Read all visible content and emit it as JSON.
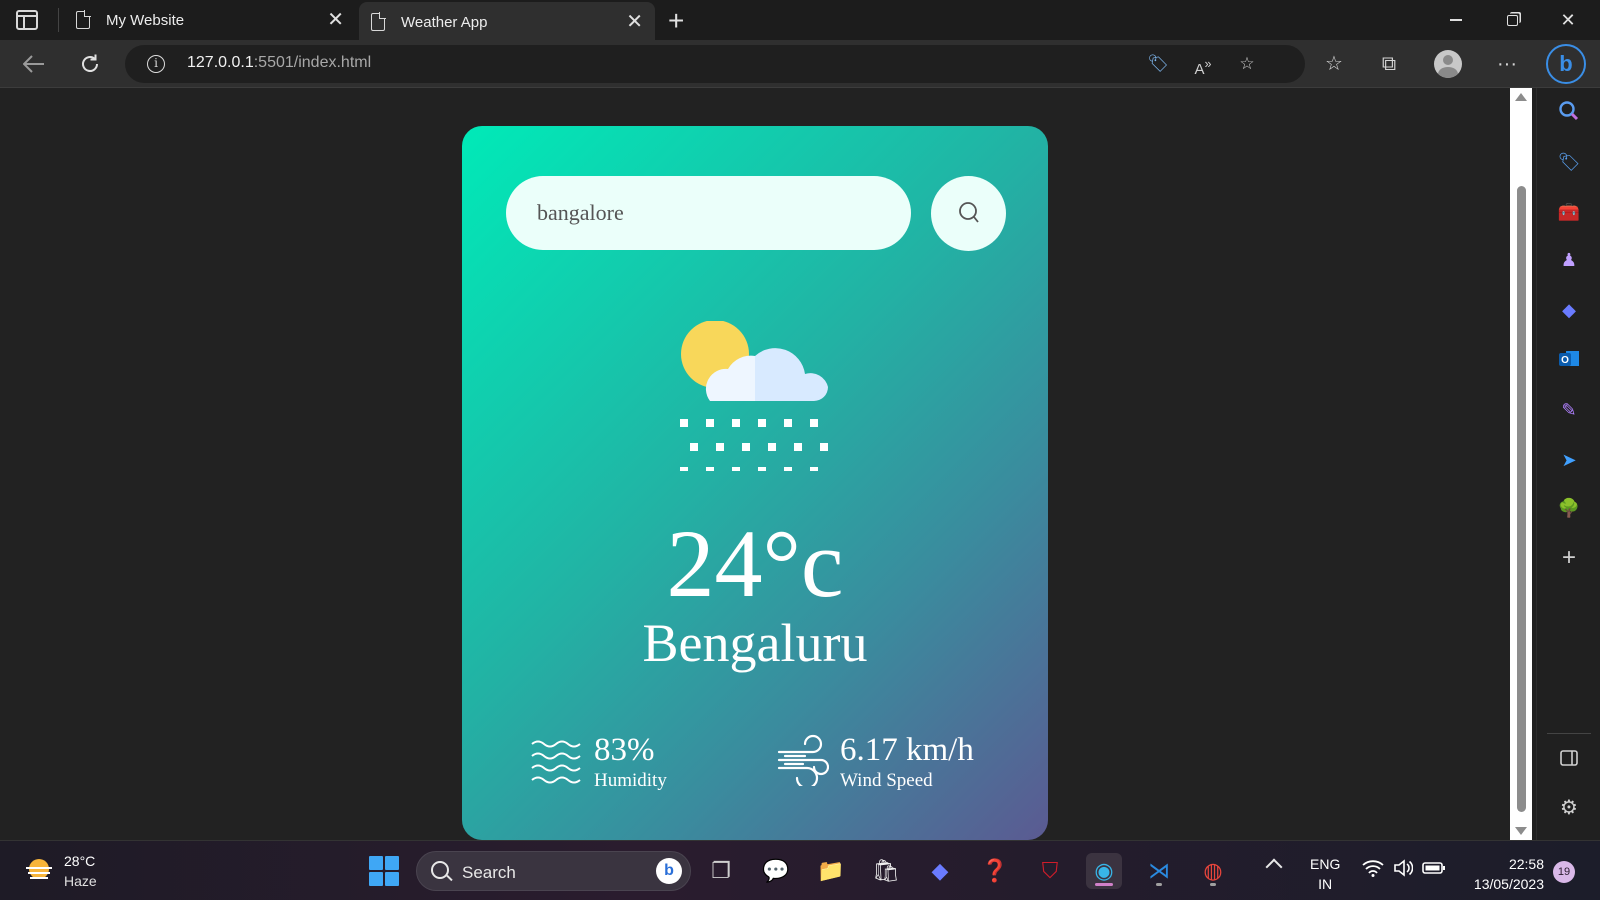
{
  "browser": {
    "tabs": [
      {
        "label": "My Website",
        "active": false
      },
      {
        "label": "Weather App",
        "active": true
      }
    ],
    "url_host": "127.0.0.1",
    "url_path": ":5501/index.html"
  },
  "app": {
    "search": {
      "value": "bangalore"
    },
    "weather_condition_icon": "sun-cloud-snow-icon",
    "temperature": "24°c",
    "city": "Bengaluru",
    "humidity": {
      "value": "83%",
      "label": "Humidity"
    },
    "wind": {
      "value": "6.17 km/h",
      "label": "Wind Speed"
    },
    "colors": {
      "gradient_start": "#00eab8",
      "gradient_end": "#5b5a92",
      "input_bg": "#ebfffa"
    }
  },
  "taskbar": {
    "weather_temp": "28°C",
    "weather_condition": "Haze",
    "search_label": "Search",
    "language": "ENG",
    "region": "IN",
    "time": "22:58",
    "date": "13/05/2023",
    "notification_count": "19"
  }
}
